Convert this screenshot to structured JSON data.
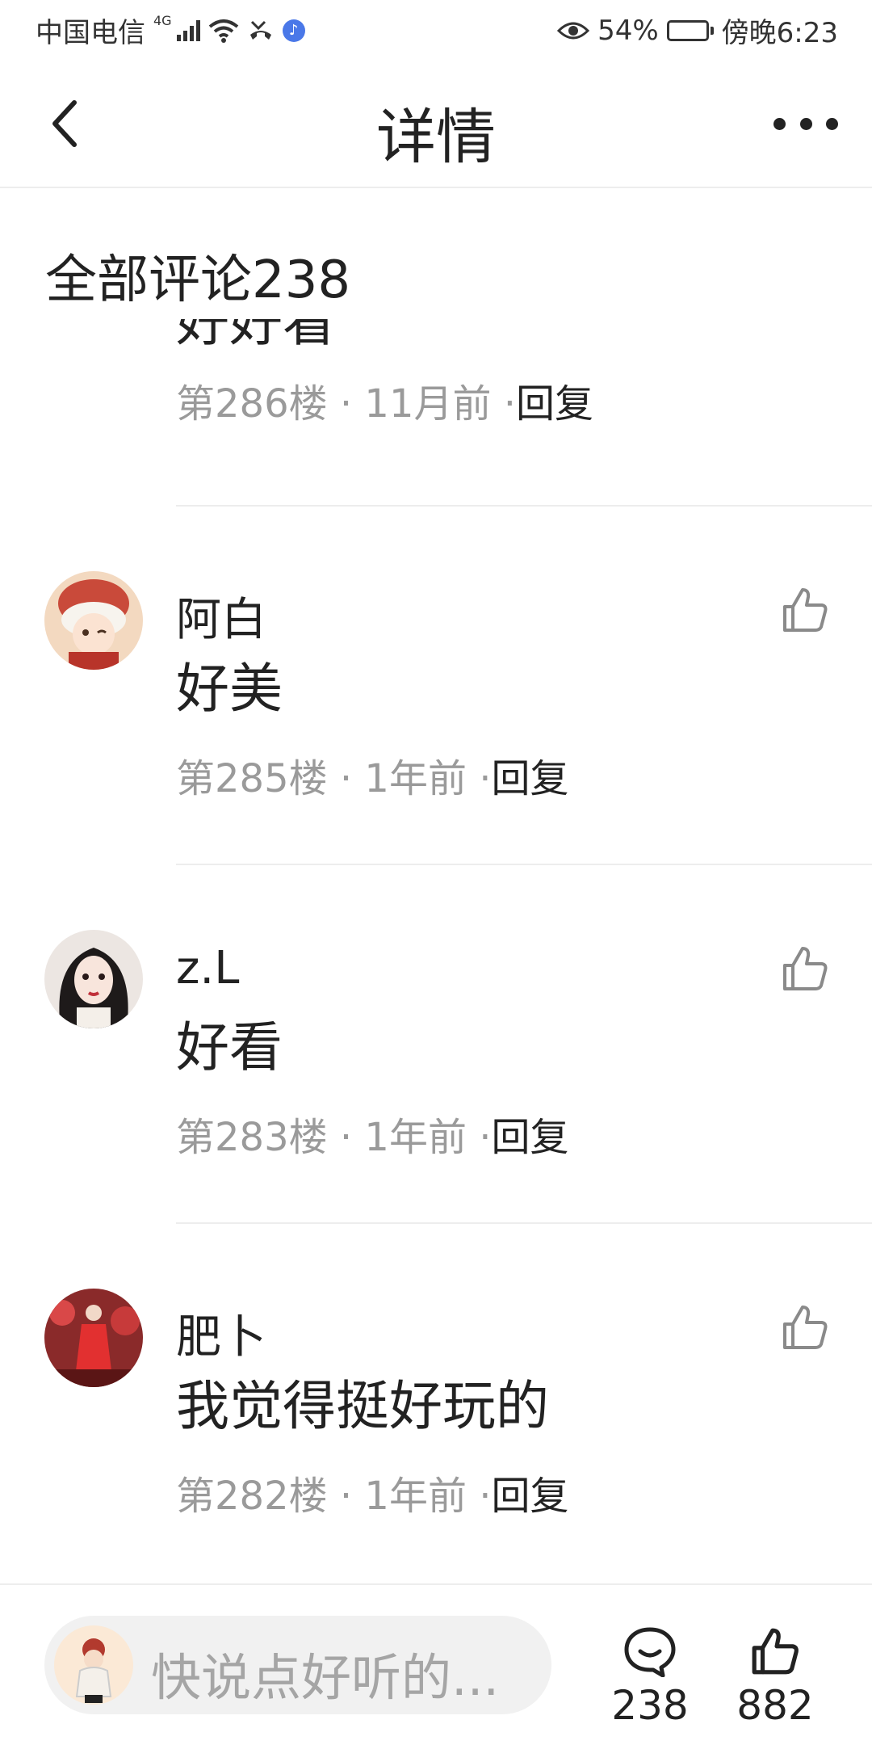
{
  "status_bar": {
    "carrier": "中国电信",
    "network": "4G",
    "battery_percent": "54%",
    "battery_level": 0.54,
    "time": "傍晚6:23",
    "icons": [
      "signal-icon",
      "wifi-icon",
      "missed-call-icon",
      "music-icon",
      "eye-icon",
      "battery-icon"
    ]
  },
  "nav": {
    "title": "详情",
    "back_icon": "chevron-left-icon",
    "more_icon": "more-dots-icon"
  },
  "section": {
    "title": "全部评论238"
  },
  "comments": [
    {
      "name": "",
      "text": "好好看",
      "floor": "第286楼",
      "time": "11月前",
      "reply": "回复"
    },
    {
      "name": "阿白",
      "text": "好美",
      "floor": "第285楼",
      "time": "1年前",
      "reply": "回复"
    },
    {
      "name": "z.L",
      "text": "好看",
      "floor": "第283楼",
      "time": "1年前",
      "reply": "回复"
    },
    {
      "name": "肥卜",
      "text": "我觉得挺好玩的",
      "floor": "第282楼",
      "time": "1年前",
      "reply": "回复"
    }
  ],
  "bottom_bar": {
    "input_placeholder": "快说点好听的...",
    "comment_count": "238",
    "like_count": "882"
  },
  "colors": {
    "text_primary": "#222222",
    "text_secondary": "#9a9a9a",
    "divider": "#ededed",
    "input_bg": "#f1f1f1",
    "placeholder": "#a5a5a5"
  }
}
